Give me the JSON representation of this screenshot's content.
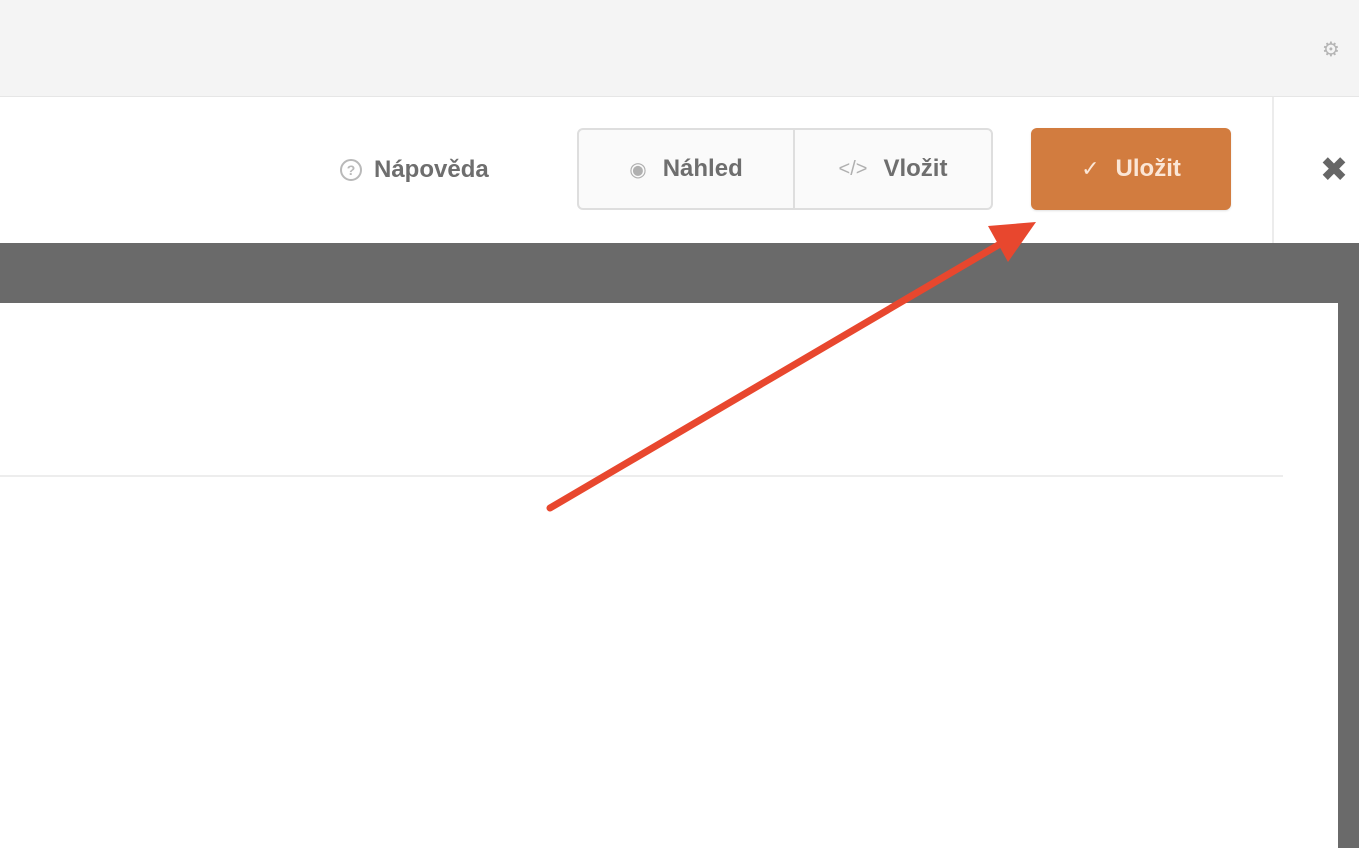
{
  "topbar": {
    "settings_icon": "gear-icon"
  },
  "toolbar": {
    "help_label": "Nápověda",
    "help_icon": "question-circle-icon",
    "preview_label": "Náhled",
    "preview_icon": "eye-icon",
    "embed_label": "Vložit",
    "embed_icon": "code-icon",
    "save_label": "Uložit",
    "save_icon": "check-icon",
    "close_icon": "close-icon"
  },
  "colors": {
    "save_button": "#d27c3f",
    "annotation_arrow": "#e8472e",
    "dark_band": "#6a6a6a"
  }
}
